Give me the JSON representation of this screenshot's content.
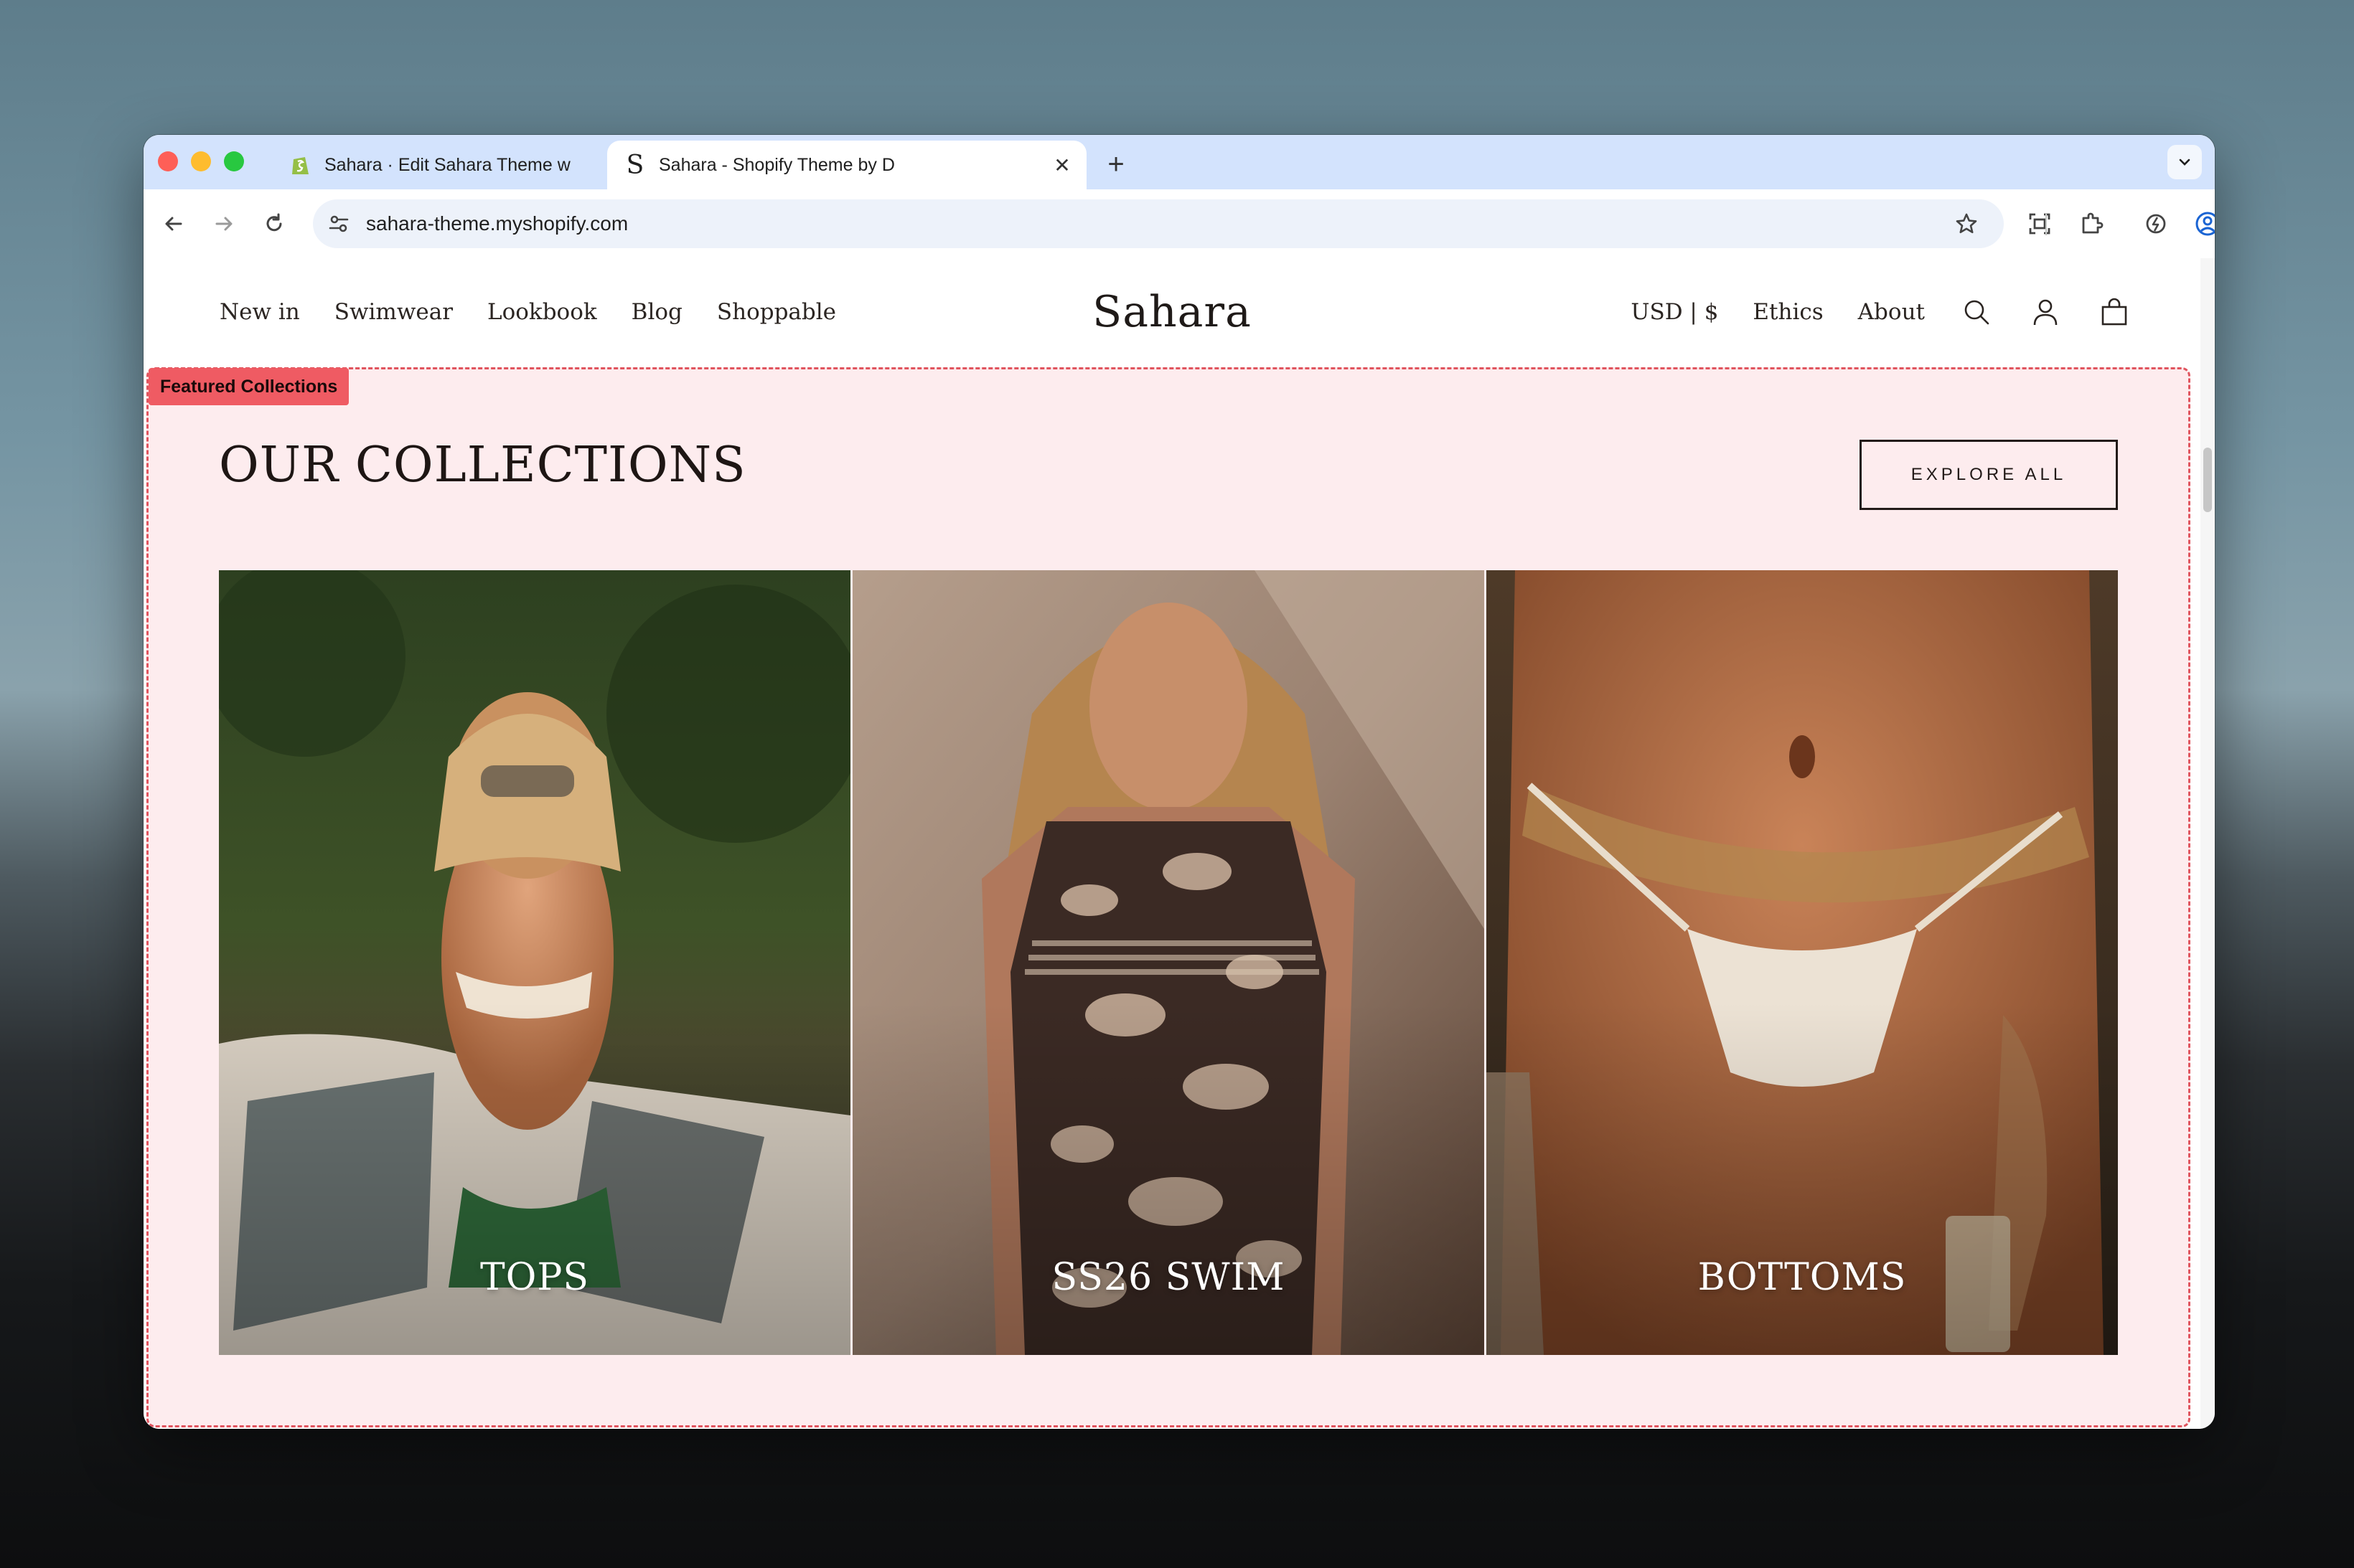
{
  "browser": {
    "tabs": [
      {
        "title": "Sahara · Edit Sahara Theme w",
        "favicon": "shopify-icon",
        "active": false
      },
      {
        "title": "Sahara - Shopify Theme by D",
        "favicon": "sahara-s-icon",
        "active": true
      }
    ],
    "new_tab": "+",
    "url": "sahara-theme.myshopify.com"
  },
  "site": {
    "nav_left": [
      "New in",
      "Swimwear",
      "Lookbook",
      "Blog",
      "Shoppable"
    ],
    "logo": "Sahara",
    "currency": "USD | $",
    "nav_right": [
      "Ethics",
      "About"
    ],
    "icons": [
      "search-icon",
      "account-icon",
      "cart-icon"
    ]
  },
  "featured": {
    "tag": "Featured Collections",
    "title": "OUR COLLECTIONS",
    "button": "EXPLORE ALL",
    "collections": [
      {
        "label": "TOPS"
      },
      {
        "label": "SS26 SWIM"
      },
      {
        "label": "BOTTOMS"
      }
    ]
  },
  "colors": {
    "section_background": "#fdecee",
    "section_outline": "#e0545e",
    "tag_background": "#ef5b63",
    "tab_strip": "#d3e3fd"
  }
}
